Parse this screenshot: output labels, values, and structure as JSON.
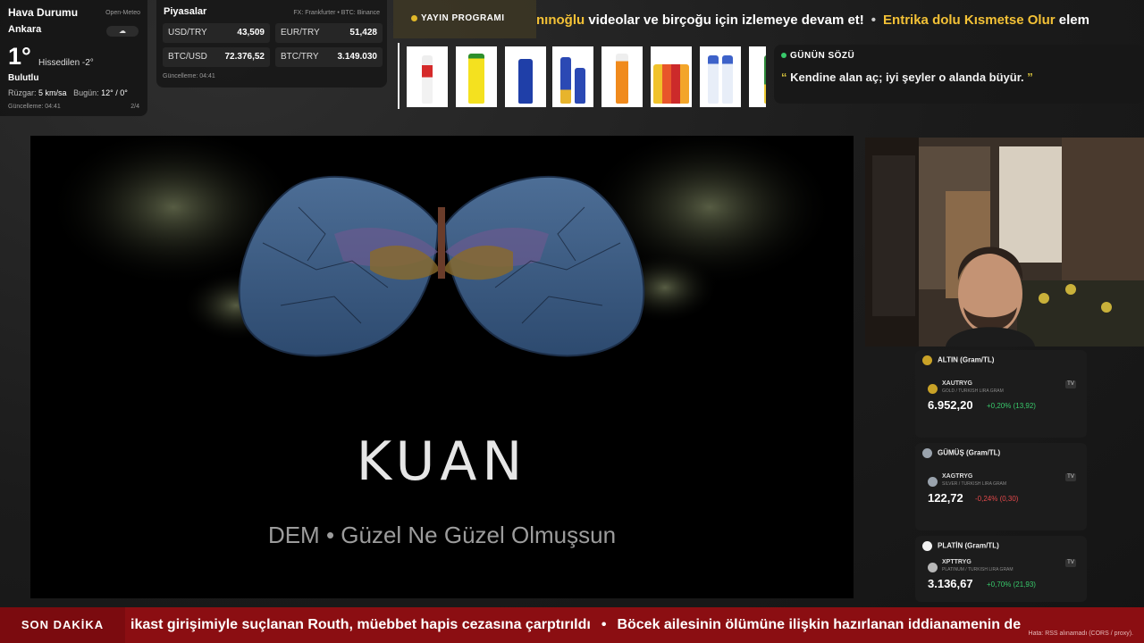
{
  "weather": {
    "title": "Hava Durumu",
    "source": "Open-Meteo",
    "city": "Ankara",
    "temp": "1°",
    "feels_like": "Hissedilen -2°",
    "condition": "Bulutlu",
    "wind_label": "Rüzgar:",
    "wind_value": "5 km/sa",
    "today_label": "Bugün:",
    "today_value": "12° / 0°",
    "updated": "Güncelleme: 04:41",
    "page": "2/4",
    "icon": "cloud-icon"
  },
  "markets": {
    "title": "Piyasalar",
    "source": "FX: Frankfurter • BTC: Binance",
    "items": [
      {
        "label": "USD/TRY",
        "value": "43,509"
      },
      {
        "label": "EUR/TRY",
        "value": "51,428"
      },
      {
        "label": "BTC/USD",
        "value": "72.376,52"
      },
      {
        "label": "BTC/TRY",
        "value": "3.149.030"
      }
    ],
    "updated": "Güncelleme: 04:41"
  },
  "schedule": {
    "label": "YAYIN PROGRAMI",
    "accent": "#e0b829"
  },
  "top_ticker": {
    "part1": "nınoğlu",
    "part2": " videolar ve birçoğu için izlemeye devam et!",
    "part3": "Entrika dolu Kısmetse Olur",
    "part4": " elem"
  },
  "quote": {
    "title": "GÜNÜN SÖZÜ",
    "open": "“",
    "text": "Kendine alan aç; iyi şeyler o alanda büyür.",
    "close": "”"
  },
  "video": {
    "title": "KUAN",
    "song": "DEM •  Güzel Ne Güzel Olmuşsun"
  },
  "metals": [
    {
      "header": "ALTIN (Gram/TL)",
      "symbol": "XAUTRYG",
      "sub": "GOLD / TURKISH LIRA GRAM",
      "price": "6.952,20",
      "change": "+0,20% (13,92)",
      "color": "#38c96b",
      "coin": "#c9a227"
    },
    {
      "header": "GÜMÜŞ (Gram/TL)",
      "symbol": "XAGTRYG",
      "sub": "SILVER / TURKISH LIRA GRAM",
      "price": "122,72",
      "change": "-0,24% (0,30)",
      "color": "#e0484a",
      "coin": "#9aa3ad"
    },
    {
      "header": "PLATİN (Gram/TL)",
      "symbol": "XPTTRYG",
      "sub": "PLATINUM / TURKISH LIRA GRAM",
      "price": "3.136,67",
      "change": "+0,70% (21,93)",
      "color": "#38c96b",
      "coin": "#b7b7b7"
    }
  ],
  "news": {
    "label": "SON DAKİKA",
    "item1": "ikast girişimiyle suçlanan Routh, müebbet hapis cezasına çarptırıldı",
    "item2": "Böcek ailesinin ölümüne ilişkin hazırlanan iddianamenin de",
    "separator": "•",
    "rss_note": "Hata: RSS alınamadı (CORS / proxy)."
  }
}
